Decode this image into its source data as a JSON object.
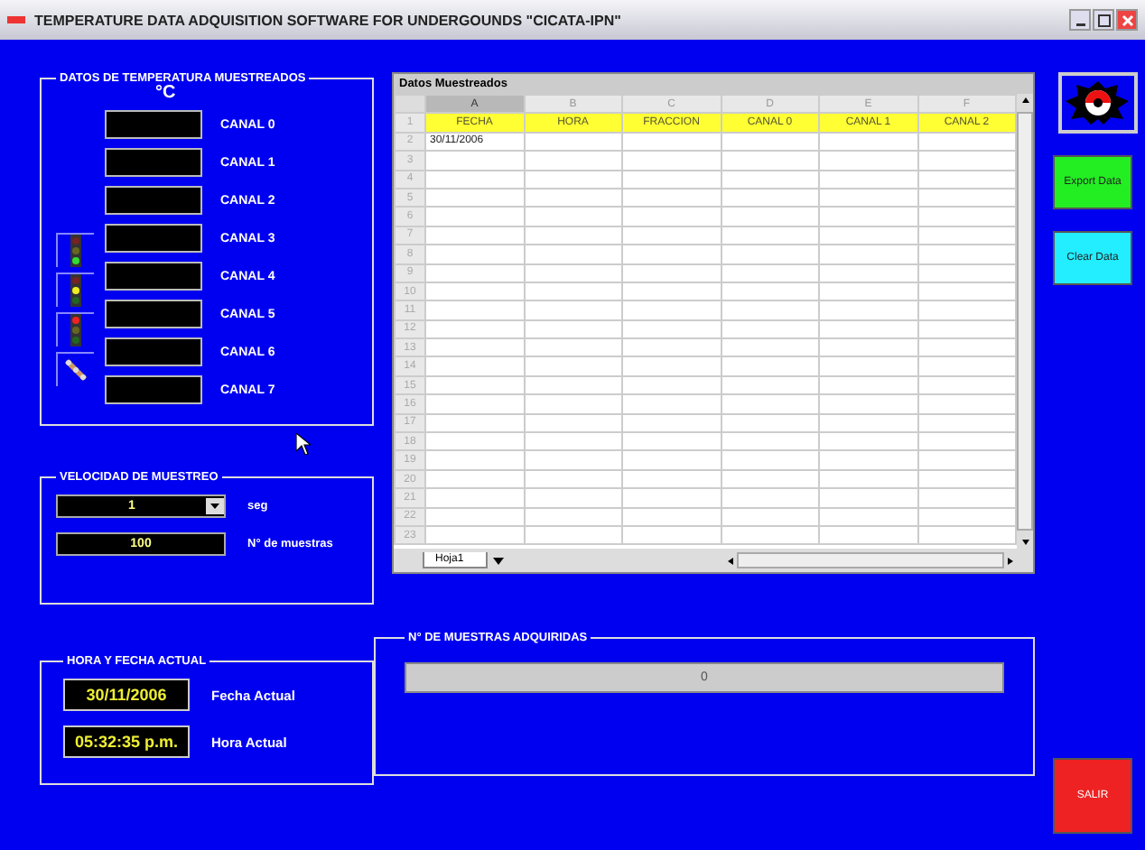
{
  "window": {
    "title": "TEMPERATURE DATA ADQUISITION SOFTWARE FOR UNDERGOUNDS  \"CICATA-IPN\""
  },
  "temperature_panel": {
    "title": "DATOS DE TEMPERATURA MUESTREADOS",
    "unit": "°C",
    "channels": [
      "CANAL 0",
      "CANAL 1",
      "CANAL 2",
      "CANAL 3",
      "CANAL 4",
      "CANAL 5",
      "CANAL 6",
      "CANAL 7"
    ],
    "indicators": [
      {
        "kind": "green"
      },
      {
        "kind": "yellow"
      },
      {
        "kind": "red"
      },
      {
        "kind": "probe"
      }
    ]
  },
  "sampling_panel": {
    "title": "VELOCIDAD DE MUESTREO",
    "interval": "1",
    "interval_unit": "seg",
    "samples": "100",
    "samples_label": "N° de muestras"
  },
  "clock_panel": {
    "title": "HORA Y FECHA ACTUAL",
    "date": "30/11/2006",
    "date_label": "Fecha Actual",
    "time": "05:32:35 p.m.",
    "time_label": "Hora Actual"
  },
  "sheet": {
    "title": "Datos Muestreados",
    "columns": [
      {
        "label": "A",
        "selected": true
      },
      {
        "label": "B",
        "selected": false
      },
      {
        "label": "C",
        "selected": false
      },
      {
        "label": "D",
        "selected": false
      },
      {
        "label": "E",
        "selected": false
      },
      {
        "label": "F",
        "selected": false
      }
    ],
    "rows": [
      {
        "number": "1",
        "kind": "header",
        "cells": [
          "FECHA",
          "HORA",
          "FRACCION",
          "CANAL 0",
          "CANAL 1",
          "CANAL 2"
        ]
      },
      {
        "number": "2",
        "kind": "data",
        "cells": [
          "30/11/2006"
        ]
      },
      {
        "number": "3",
        "kind": "data"
      },
      {
        "number": "4",
        "kind": "data"
      },
      {
        "number": "5",
        "kind": "data"
      },
      {
        "number": "6",
        "kind": "data"
      },
      {
        "number": "7",
        "kind": "data"
      },
      {
        "number": "8",
        "kind": "data"
      },
      {
        "number": "9",
        "kind": "data"
      },
      {
        "number": "10",
        "kind": "data"
      },
      {
        "number": "11",
        "kind": "data"
      },
      {
        "number": "12",
        "kind": "data"
      },
      {
        "number": "13",
        "kind": "data"
      },
      {
        "number": "14",
        "kind": "data"
      },
      {
        "number": "15",
        "kind": "data"
      },
      {
        "number": "16",
        "kind": "data"
      },
      {
        "number": "17",
        "kind": "data"
      },
      {
        "number": "18",
        "kind": "data"
      },
      {
        "number": "19",
        "kind": "data"
      },
      {
        "number": "20",
        "kind": "data"
      },
      {
        "number": "21",
        "kind": "data"
      },
      {
        "number": "22",
        "kind": "data"
      },
      {
        "number": "23",
        "kind": "data"
      }
    ],
    "sheet_tab": "Hoja1"
  },
  "progress_panel": {
    "title": "N° DE MUESTRAS ADQUIRIDAS",
    "level": 0,
    "reading": "0"
  },
  "buttons": [
    {
      "label": "Export Data",
      "color": "#22ee22"
    },
    {
      "label": "Clear Data",
      "color": "#22eeff"
    },
    {
      "label": "SALIR",
      "color": "#ee2222"
    }
  ]
}
